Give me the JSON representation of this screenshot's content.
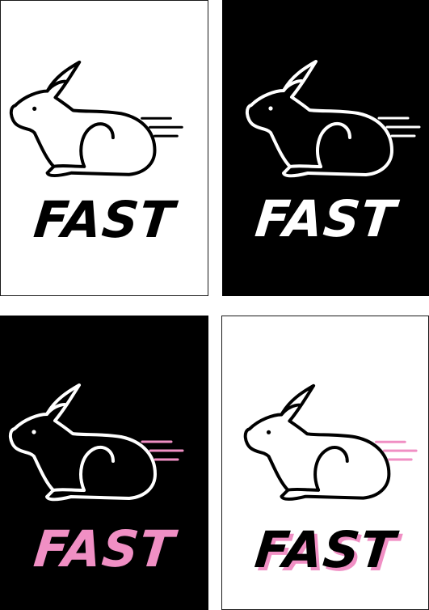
{
  "colors": {
    "black": "#000000",
    "white": "#ffffff",
    "pink": "#f08fc4"
  },
  "cards": [
    {
      "variant": "black-on-white",
      "icon": "rabbit-icon",
      "wordmark": "FAST"
    },
    {
      "variant": "white-on-black",
      "icon": "rabbit-icon",
      "wordmark": "FAST"
    },
    {
      "variant": "pink-on-black",
      "icon": "rabbit-icon",
      "wordmark": "FAST"
    },
    {
      "variant": "black-with-pink-shadow-on-white",
      "icon": "rabbit-icon",
      "wordmark": "FAST"
    }
  ]
}
